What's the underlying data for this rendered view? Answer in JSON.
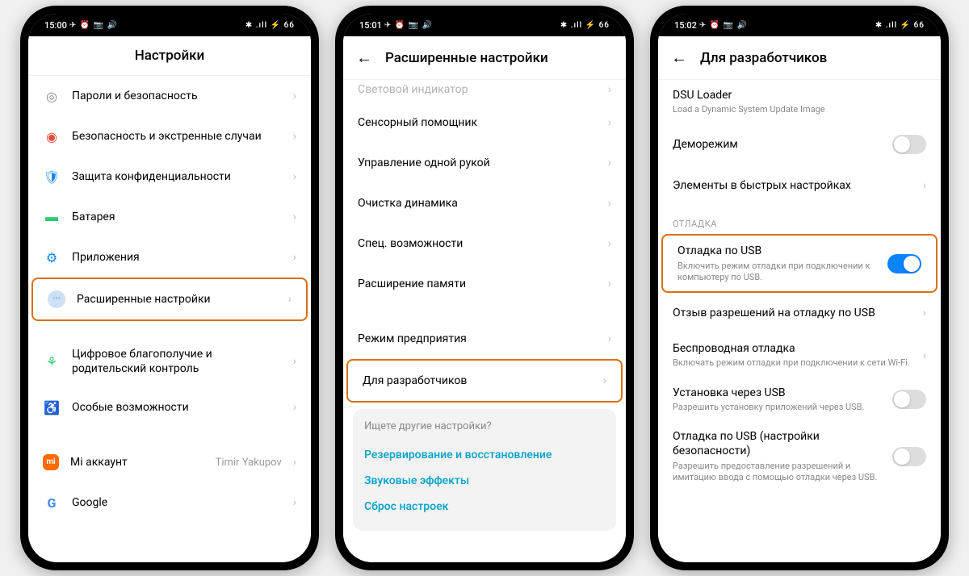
{
  "status": {
    "time1": "15:00",
    "time2": "15:01",
    "time3": "15:02",
    "left_icons": "✈ ⏰ 📷 🔊",
    "right_icons": "✱ .ıll ⚡ 66"
  },
  "phone1": {
    "title": "Настройки",
    "items": [
      {
        "label": "Пароли и безопасность"
      },
      {
        "label": "Безопасность и экстренные случаи"
      },
      {
        "label": "Защита конфиденциальности"
      },
      {
        "label": "Батарея"
      },
      {
        "label": "Приложения"
      },
      {
        "label": "Расширенные настройки"
      },
      {
        "label": "Цифровое благополучие и родительский контроль"
      },
      {
        "label": "Особые возможности"
      },
      {
        "label": "Mi аккаунт",
        "value": "Timir Yakupov"
      },
      {
        "label": "Google"
      }
    ]
  },
  "phone2": {
    "title": "Расширенные настройки",
    "cut_item": "Световой индикатор",
    "items": [
      {
        "label": "Сенсорный помощник"
      },
      {
        "label": "Управление одной рукой"
      },
      {
        "label": "Очистка динамика"
      },
      {
        "label": "Спец. возможности"
      },
      {
        "label": "Расширение памяти"
      },
      {
        "label": "Режим предприятия"
      },
      {
        "label": "Для разработчиков"
      }
    ],
    "suggestions": {
      "title": "Ищете другие настройки?",
      "links": [
        "Резервирование и восстановление",
        "Звуковые эффекты",
        "Сброс настроек"
      ]
    }
  },
  "phone3": {
    "title": "Для разработчиков",
    "top_items": [
      {
        "label": "DSU Loader",
        "sub": "Load a Dynamic System Update Image"
      },
      {
        "label": "Деморежим",
        "toggle": "off"
      },
      {
        "label": "Элементы в быстрых настройках",
        "chevron": true
      }
    ],
    "section": "ОТЛАДКА",
    "debug_items": [
      {
        "label": "Отладка по USB",
        "sub": "Включить режим отладки при подключении к компьютеру по USB.",
        "toggle": "on",
        "highlight": true
      },
      {
        "label": "Отзыв разрешений на отладку по USB",
        "chevron": true
      },
      {
        "label": "Беспроводная отладка",
        "sub": "Включать режим отладки при подключении к сети Wi-Fi.",
        "chevron": true
      },
      {
        "label": "Установка через USB",
        "sub": "Разрешить установку приложений через USB.",
        "toggle": "off"
      },
      {
        "label": "Отладка по USB (настройки безопасности)",
        "sub": "Разрешить предоставление разрешений и имитацию ввода с помощью отладки через USB.",
        "toggle": "off"
      }
    ]
  }
}
